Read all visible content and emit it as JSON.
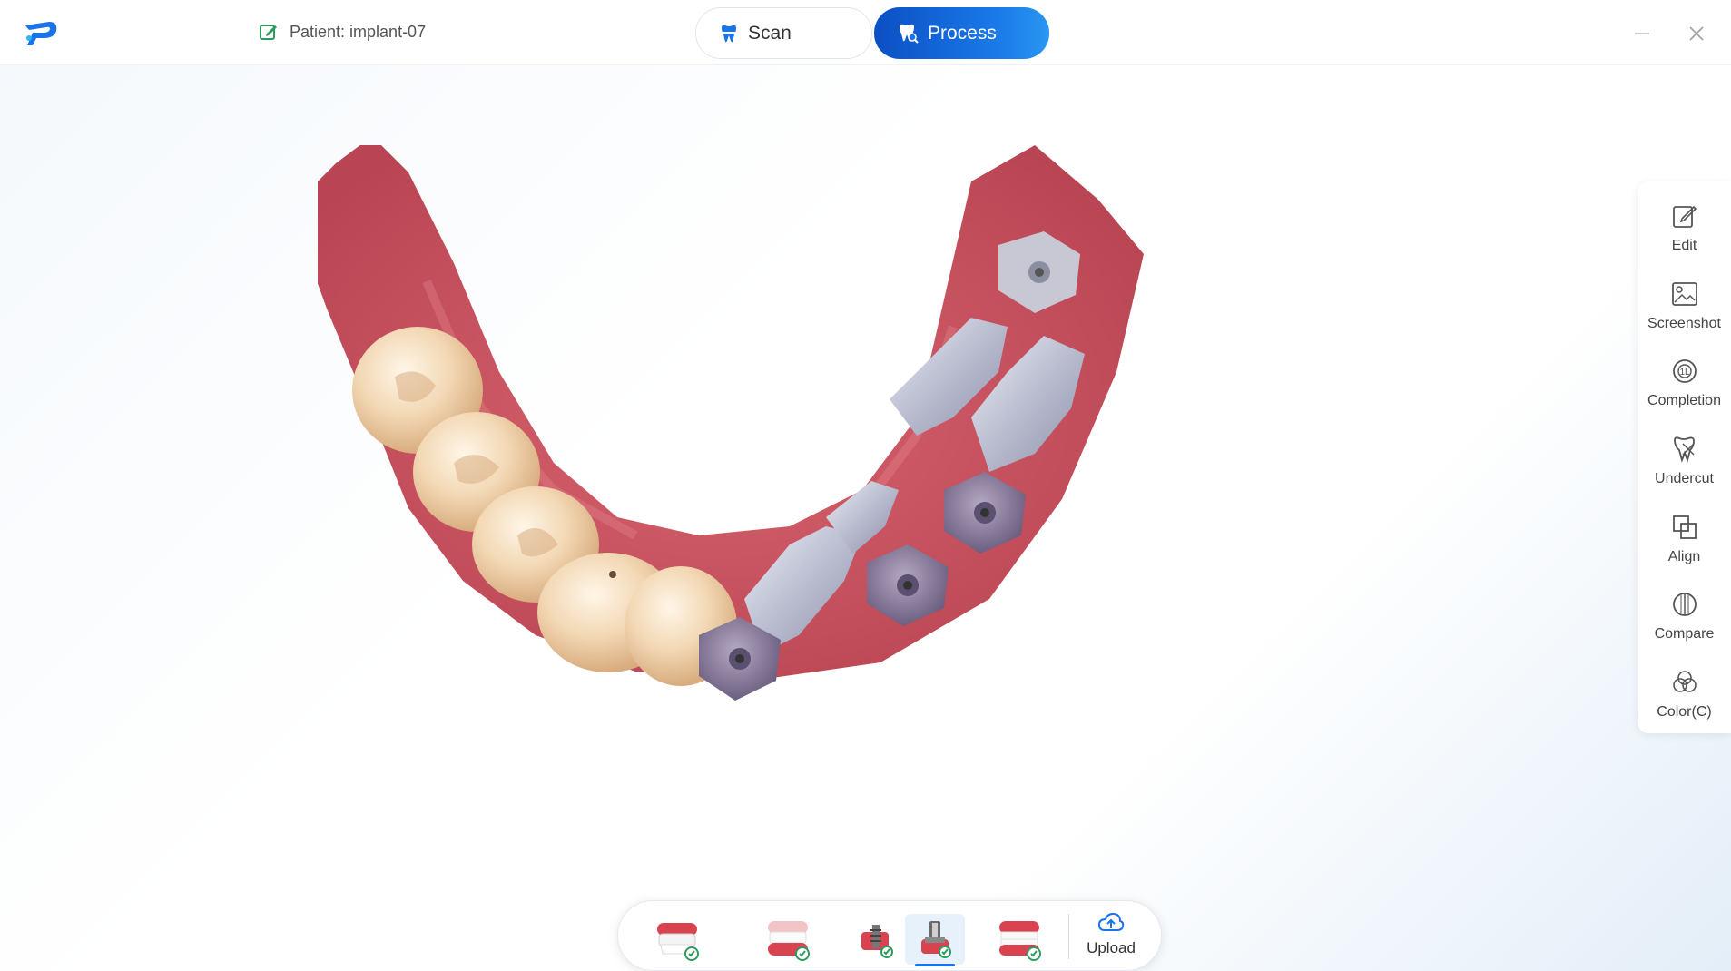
{
  "header": {
    "logo_icon": "brand-logo-icon",
    "patient_label": "Patient: implant-07",
    "tabs": [
      {
        "label": "Scan",
        "icon": "tooth-scan-icon",
        "active": false
      },
      {
        "label": "Process",
        "icon": "tooth-process-icon",
        "active": true
      }
    ],
    "window_controls": [
      "minimize-icon",
      "close-icon"
    ]
  },
  "colors": {
    "accent": "#1a73e8",
    "tab_gradient_start": "#0b4fc4",
    "tab_gradient_end": "#2a96f2",
    "gum": "#c9505e",
    "tooth": "#f0d8b8",
    "scanbody": "#c8c8d8"
  },
  "right_toolbar": {
    "items": [
      {
        "label": "Edit",
        "icon": "edit-icon"
      },
      {
        "label": "Screenshot",
        "icon": "screenshot-icon"
      },
      {
        "label": "Completion",
        "icon": "completion-icon"
      },
      {
        "label": "Undercut",
        "icon": "undercut-icon"
      },
      {
        "label": "Align",
        "icon": "align-icon"
      },
      {
        "label": "Compare",
        "icon": "compare-icon"
      },
      {
        "label": "Color(C)",
        "icon": "color-icon"
      }
    ]
  },
  "bottom_bar": {
    "steps": [
      {
        "name": "upper-jaw-step",
        "icon": "upper-jaw-icon",
        "done": true,
        "active": false
      },
      {
        "name": "lower-jaw-step",
        "icon": "lower-jaw-icon",
        "done": true,
        "active": false
      },
      {
        "name": "implant-step",
        "icon": "implant-icon",
        "done": true,
        "active": false
      },
      {
        "name": "scanbody-step",
        "icon": "scanbody-icon",
        "done": true,
        "active": true
      },
      {
        "name": "bite-step",
        "icon": "bite-icon",
        "done": true,
        "active": false
      }
    ],
    "upload_label": "Upload",
    "upload_icon": "cloud-upload-icon"
  }
}
